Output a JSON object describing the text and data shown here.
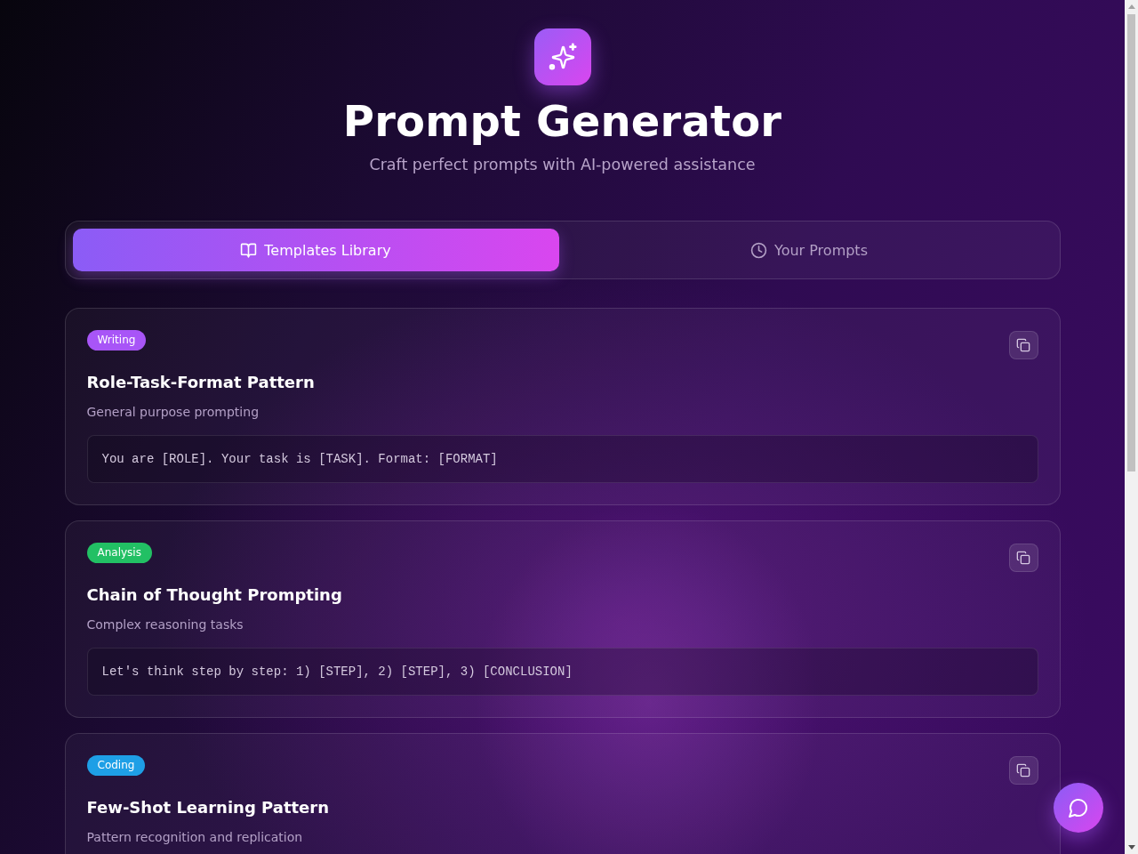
{
  "header": {
    "title": "Prompt Generator",
    "subtitle": "Craft perfect prompts with AI-powered assistance"
  },
  "tabs": [
    {
      "kind": "templates",
      "label": "Templates Library",
      "selected": true
    },
    {
      "kind": "history",
      "label": "Your Prompts",
      "selected": false
    }
  ],
  "templates": [
    {
      "category": "Writing",
      "color": "#a855f7",
      "title": "Role-Task-Format Pattern",
      "description": "General purpose prompting",
      "prompt": "You are [ROLE]. Your task is [TASK]. Format: [FORMAT]"
    },
    {
      "category": "Analysis",
      "color": "#22c064",
      "title": "Chain of Thought Prompting",
      "description": "Complex reasoning tasks",
      "prompt": "Let's think step by step: 1) [STEP], 2) [STEP], 3) [CONCLUSION]"
    },
    {
      "category": "Coding",
      "color": "#1e9fe6",
      "title": "Few-Shot Learning Pattern",
      "description": "Pattern recognition and replication"
    }
  ]
}
